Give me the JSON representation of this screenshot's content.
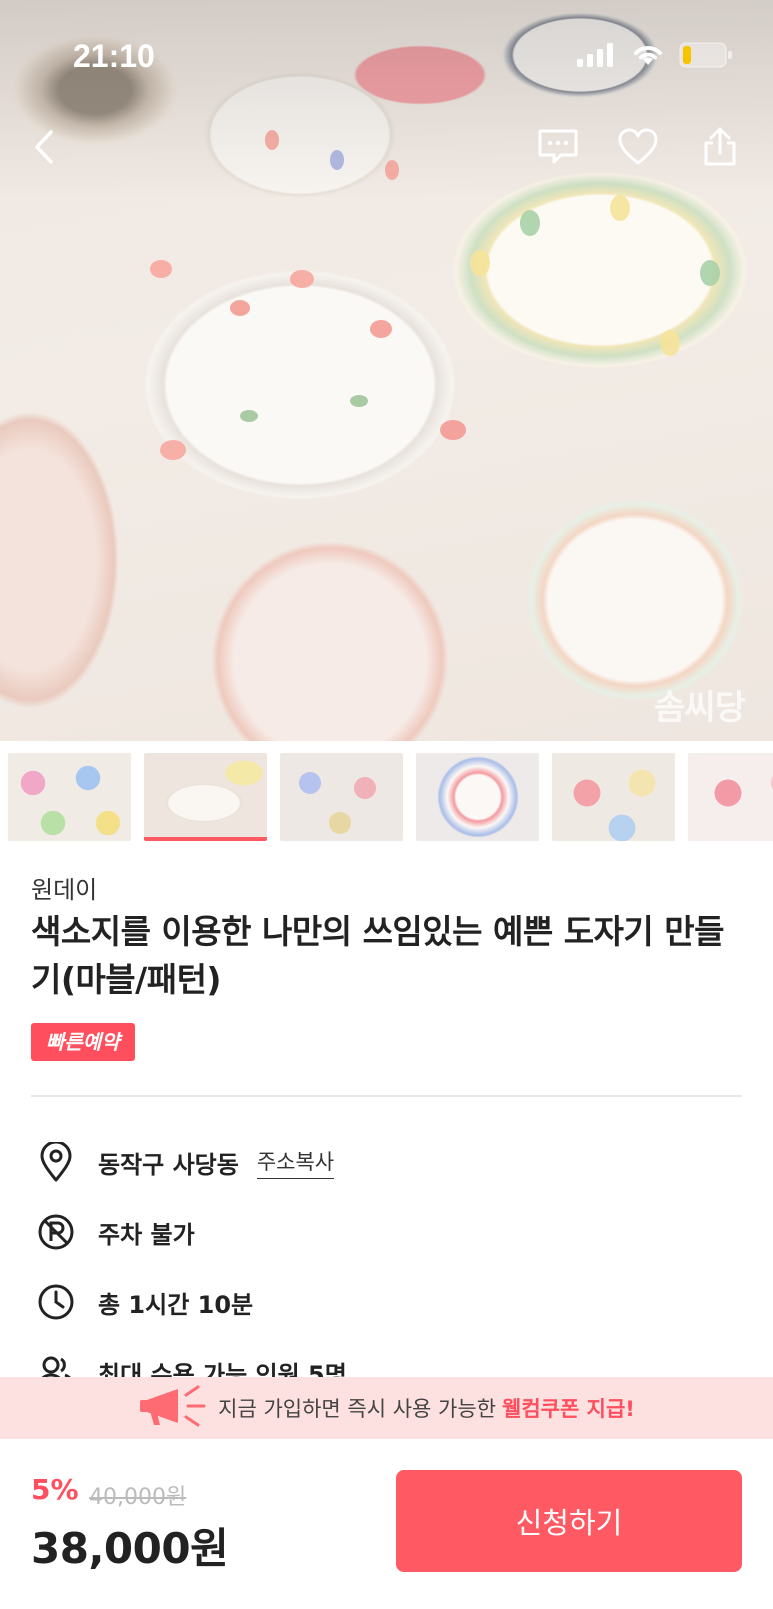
{
  "status_bar": {
    "time": "21:10"
  },
  "hero": {
    "watermark": "솜씨당"
  },
  "nav": {
    "icons": [
      "chevron-left-icon",
      "chat-icon",
      "heart-icon",
      "share-icon"
    ]
  },
  "product": {
    "category": "원데이",
    "title": "색소지를 이용한 나만의 쓰임있는 예쁜 도자기 만들기(마블/패턴)",
    "badge": "빠른예약"
  },
  "info": {
    "location": "동작구 사당동",
    "copy_address": "주소복사",
    "parking": "주차 불가",
    "duration": "총 1시간 10분",
    "capacity": "최대 수용 가능 인원 5명"
  },
  "promo": {
    "text": "지금 가입하면 즉시 사용 가능한",
    "highlight": "웰컴쿠폰 지급!"
  },
  "pricing": {
    "discount": "5%",
    "original_price": "40,000원",
    "price": "38,000원",
    "apply_label": "신청하기"
  },
  "colors": {
    "accent": "#ff5a64",
    "badge": "#ff4f5e",
    "promo_bg": "#fde0e0"
  }
}
